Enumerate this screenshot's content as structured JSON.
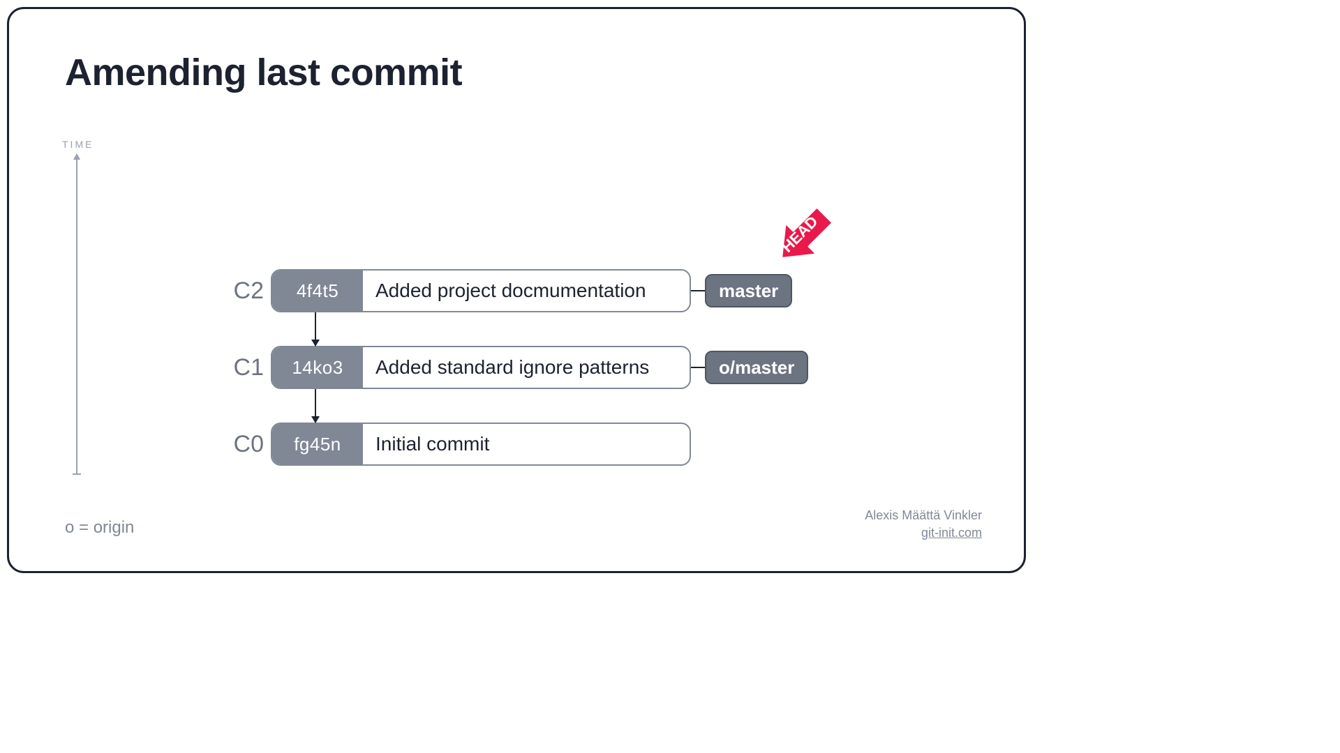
{
  "title": "Amending last commit",
  "timeLabel": "TIME",
  "commits": [
    {
      "label": "C2",
      "hash": "4f4t5",
      "message": "Added project docmumentation",
      "branch": "master",
      "head": true
    },
    {
      "label": "C1",
      "hash": "14ko3",
      "message": "Added standard ignore patterns",
      "branch": "o/master",
      "head": false
    },
    {
      "label": "C0",
      "hash": "fg45n",
      "message": "Initial commit",
      "branch": null,
      "head": false
    }
  ],
  "headLabel": "HEAD",
  "legend": "o = origin",
  "author": "Alexis Määttä Vinkler",
  "site": "git-init.com"
}
